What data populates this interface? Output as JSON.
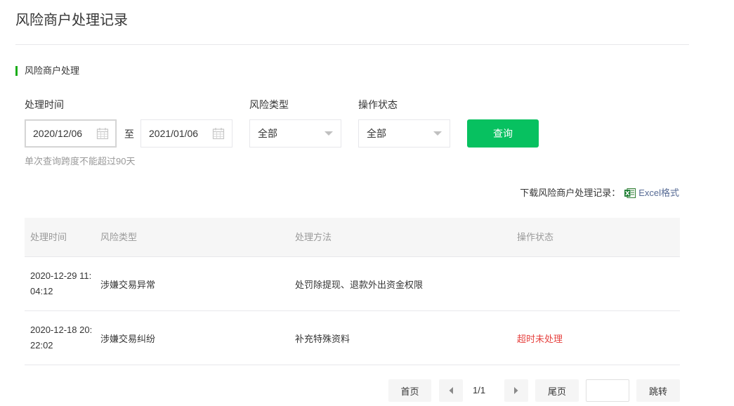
{
  "page": {
    "title": "风险商户处理记录"
  },
  "section": {
    "title": "风险商户处理"
  },
  "filters": {
    "time_label": "处理时间",
    "start_date": "2020/12/06",
    "to_label": "至",
    "end_date": "2021/01/06",
    "risk_type_label": "风险类型",
    "risk_type_value": "全部",
    "status_label": "操作状态",
    "status_value": "全部",
    "query_button": "查询",
    "hint": "单次查询跨度不能超过90天"
  },
  "download": {
    "label": "下载风险商户处理记录：",
    "link": "Excel格式",
    "icon": "excel-icon"
  },
  "table": {
    "headers": [
      "处理时间",
      "风险类型",
      "处理方法",
      "操作状态"
    ],
    "rows": [
      {
        "time": "2020-12-29 11:04:12",
        "type": "涉嫌交易异常",
        "method": "处罚除提现、退款外出资金权限",
        "status": ""
      },
      {
        "time": "2020-12-18 20:22:02",
        "type": "涉嫌交易纠纷",
        "method": "补充特殊资料",
        "status": "超时未处理"
      }
    ]
  },
  "pager": {
    "first": "首页",
    "page": "1/1",
    "last": "尾页",
    "jump_value": "",
    "jump": "跳转"
  },
  "colors": {
    "primary": "#07c160",
    "accent_bar": "#1aad19",
    "warn": "#e64340",
    "link": "#576b95"
  }
}
